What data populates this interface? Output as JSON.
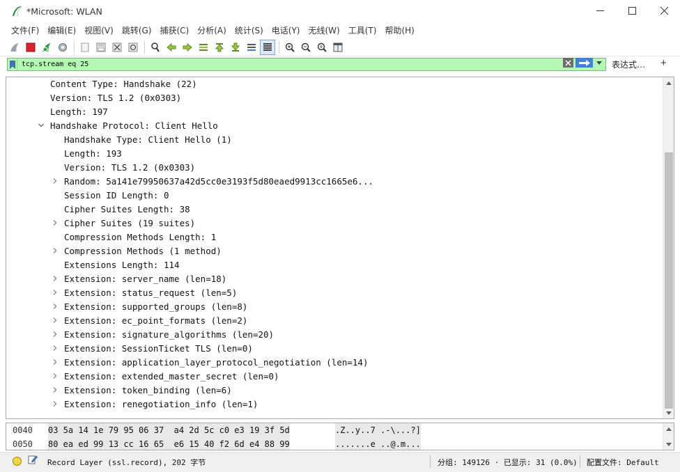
{
  "window": {
    "title": "*Microsoft: WLAN",
    "minimize_glyph": "—",
    "maximize_glyph": "☐",
    "close_glyph": "✕"
  },
  "menu": [
    "文件(F)",
    "编辑(E)",
    "视图(V)",
    "跳转(G)",
    "捕获(C)",
    "分析(A)",
    "统计(S)",
    "电话(Y)",
    "无线(W)",
    "工具(T)",
    "帮助(H)"
  ],
  "toolbar": {
    "icons": [
      "shark-fin-start-icon",
      "stop-icon",
      "restart-icon",
      "options-icon",
      "open-file-icon",
      "save-file-icon",
      "close-file-icon",
      "reload-icon",
      "find-packet-icon",
      "go-back-icon",
      "go-forward-icon",
      "go-to-packet-icon",
      "first-packet-icon",
      "last-packet-icon",
      "autoscroll-icon",
      "colorize-icon",
      "zoom-in-icon",
      "zoom-out-icon",
      "zoom-normal-icon",
      "resize-columns-icon"
    ]
  },
  "filter": {
    "value": "tcp.stream eq 25",
    "expression_label": "表达式…",
    "add_label": "+"
  },
  "colors": {
    "filter_bg": "#b2f7b2",
    "filter_apply": "#3f82d6"
  },
  "details": {
    "rows": [
      {
        "text": "Content Type: Handshake (22)",
        "indent": 0,
        "caret": ""
      },
      {
        "text": "Version: TLS 1.2 (0x0303)",
        "indent": 0,
        "caret": ""
      },
      {
        "text": "Length: 197",
        "indent": 0,
        "caret": ""
      },
      {
        "text": "Handshake Protocol: Client Hello",
        "indent": 0,
        "caret": "expanded"
      },
      {
        "text": "Handshake Type: Client Hello (1)",
        "indent": 1,
        "caret": ""
      },
      {
        "text": "Length: 193",
        "indent": 1,
        "caret": ""
      },
      {
        "text": "Version: TLS 1.2 (0x0303)",
        "indent": 1,
        "caret": ""
      },
      {
        "text": "Random: 5a141e79950637a42d5cc0e3193f5d80eaed9913cc1665e6...",
        "indent": 1,
        "caret": "collapsed"
      },
      {
        "text": "Session ID Length: 0",
        "indent": 1,
        "caret": ""
      },
      {
        "text": "Cipher Suites Length: 38",
        "indent": 1,
        "caret": ""
      },
      {
        "text": "Cipher Suites (19 suites)",
        "indent": 1,
        "caret": "collapsed"
      },
      {
        "text": "Compression Methods Length: 1",
        "indent": 1,
        "caret": ""
      },
      {
        "text": "Compression Methods (1 method)",
        "indent": 1,
        "caret": "collapsed"
      },
      {
        "text": "Extensions Length: 114",
        "indent": 1,
        "caret": ""
      },
      {
        "text": "Extension: server_name (len=18)",
        "indent": 1,
        "caret": "collapsed"
      },
      {
        "text": "Extension: status_request (len=5)",
        "indent": 1,
        "caret": "collapsed"
      },
      {
        "text": "Extension: supported_groups (len=8)",
        "indent": 1,
        "caret": "collapsed"
      },
      {
        "text": "Extension: ec_point_formats (len=2)",
        "indent": 1,
        "caret": "collapsed"
      },
      {
        "text": "Extension: signature_algorithms (len=20)",
        "indent": 1,
        "caret": "collapsed"
      },
      {
        "text": "Extension: SessionTicket TLS (len=0)",
        "indent": 1,
        "caret": "collapsed"
      },
      {
        "text": "Extension: application_layer_protocol_negotiation (len=14)",
        "indent": 1,
        "caret": "collapsed"
      },
      {
        "text": "Extension: extended_master_secret (len=0)",
        "indent": 1,
        "caret": "collapsed"
      },
      {
        "text": "Extension: token_binding (len=6)",
        "indent": 1,
        "caret": "collapsed"
      },
      {
        "text": "Extension: renegotiation_info (len=1)",
        "indent": 1,
        "caret": "collapsed"
      }
    ]
  },
  "hex": {
    "rows": [
      {
        "offset": "0040",
        "bytes": "03 5a 14 1e 79 95 06 37  a4 2d 5c c0 e3 19 3f 5d",
        "ascii": ".Z..y..7 .-\\...?]"
      },
      {
        "offset": "0050",
        "bytes": "80 ea ed 99 13 cc 16 65  e6 15 40 f2 6d e4 88 99",
        "ascii": ".......e ..@.m..."
      }
    ]
  },
  "status": {
    "field": "Record Layer (ssl.record), 202 字节",
    "packets": "分组: 149126 · 已显示: 31 (0.0%)",
    "profile": "配置文件: Default"
  }
}
